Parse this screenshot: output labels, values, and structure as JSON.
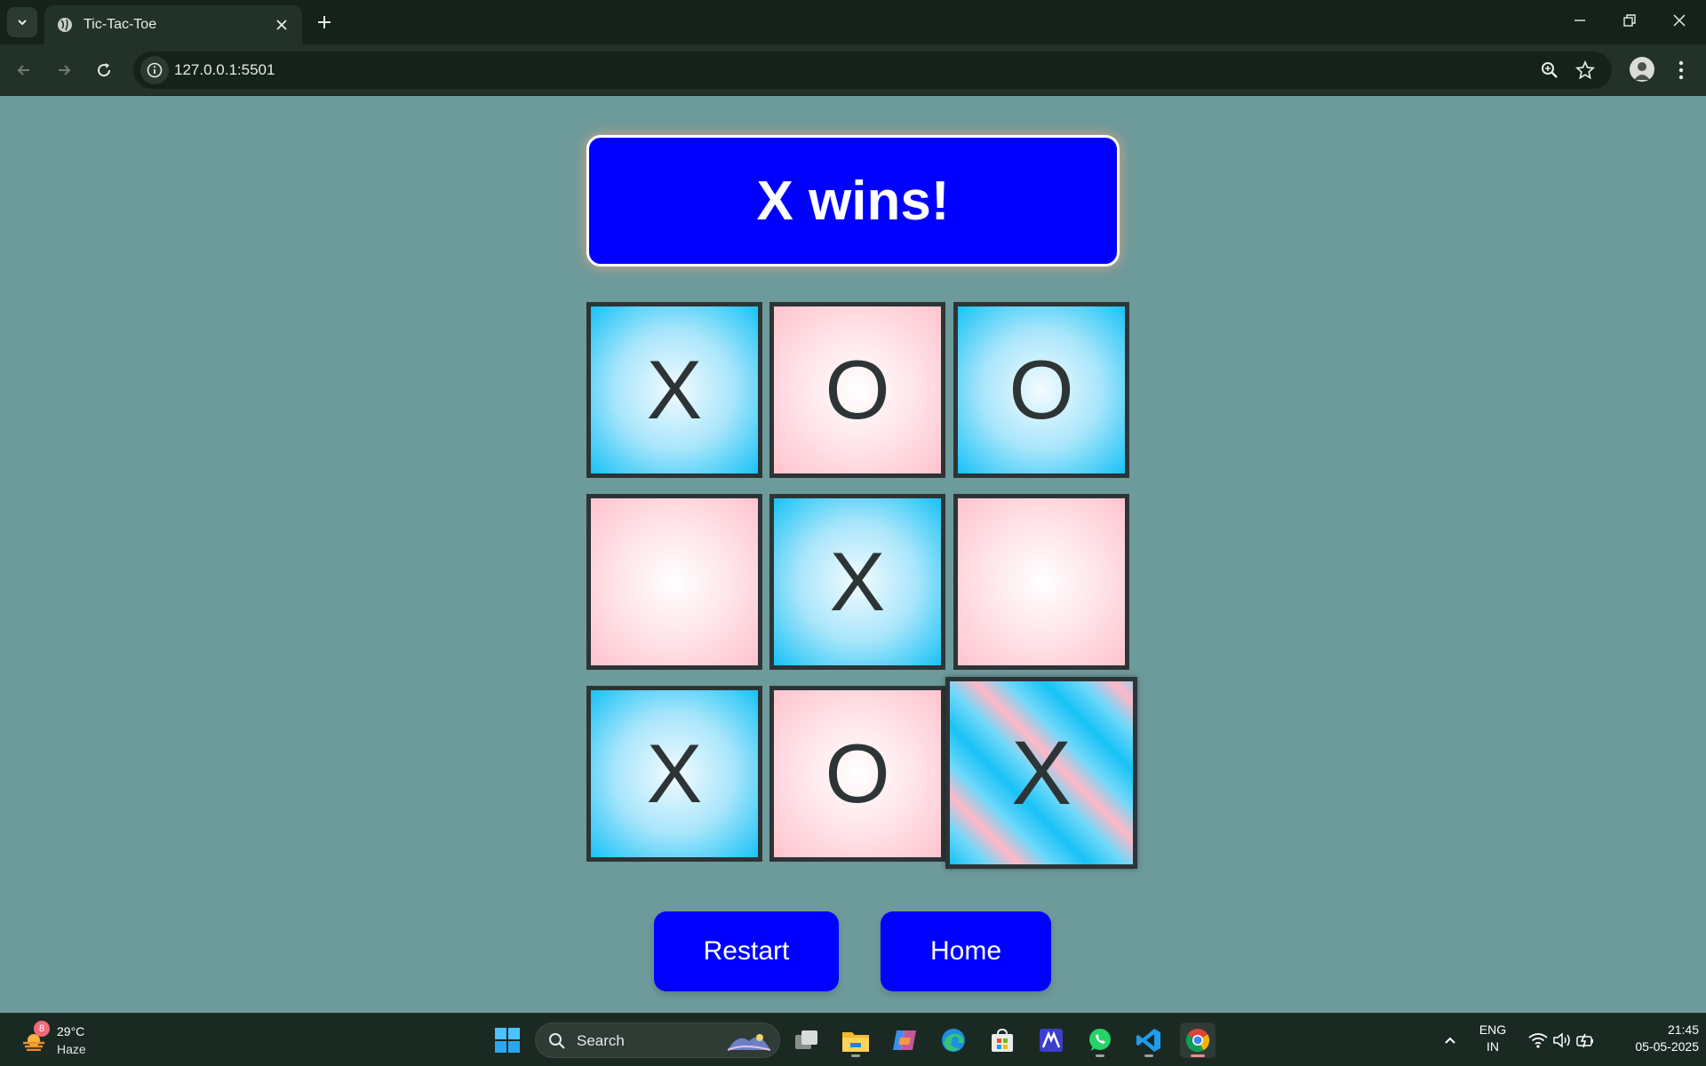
{
  "browser": {
    "tab_title": "Tic-Tac-Toe",
    "url": "127.0.0.1:5501"
  },
  "game": {
    "status": "X wins!",
    "board": [
      {
        "mark": "X",
        "style": "blue"
      },
      {
        "mark": "O",
        "style": "pink"
      },
      {
        "mark": "O",
        "style": "blue"
      },
      {
        "mark": "",
        "style": "pink"
      },
      {
        "mark": "X",
        "style": "blue"
      },
      {
        "mark": "",
        "style": "pink"
      },
      {
        "mark": "X",
        "style": "blue"
      },
      {
        "mark": "O",
        "style": "pink"
      },
      {
        "mark": "X",
        "style": "win"
      }
    ],
    "restart_label": "Restart",
    "home_label": "Home"
  },
  "colors": {
    "page_bg": "#6d9a9b",
    "accent_blue": "#0000fe",
    "cell_blue": "#18c2f6",
    "cell_pink": "#ffc3cd",
    "cell_border": "#2d3436"
  },
  "taskbar": {
    "weather_badge": "8",
    "temperature": "29°C",
    "condition": "Haze",
    "search_label": "Search",
    "lang_line1": "ENG",
    "lang_line2": "IN",
    "time": "21:45",
    "date": "05-05-2025",
    "pinned": [
      "task-view-icon",
      "file-explorer-icon",
      "copilot-icon",
      "edge-icon",
      "store-icon",
      "app-icon",
      "whatsapp-icon",
      "vscode-icon",
      "chrome-icon"
    ]
  }
}
